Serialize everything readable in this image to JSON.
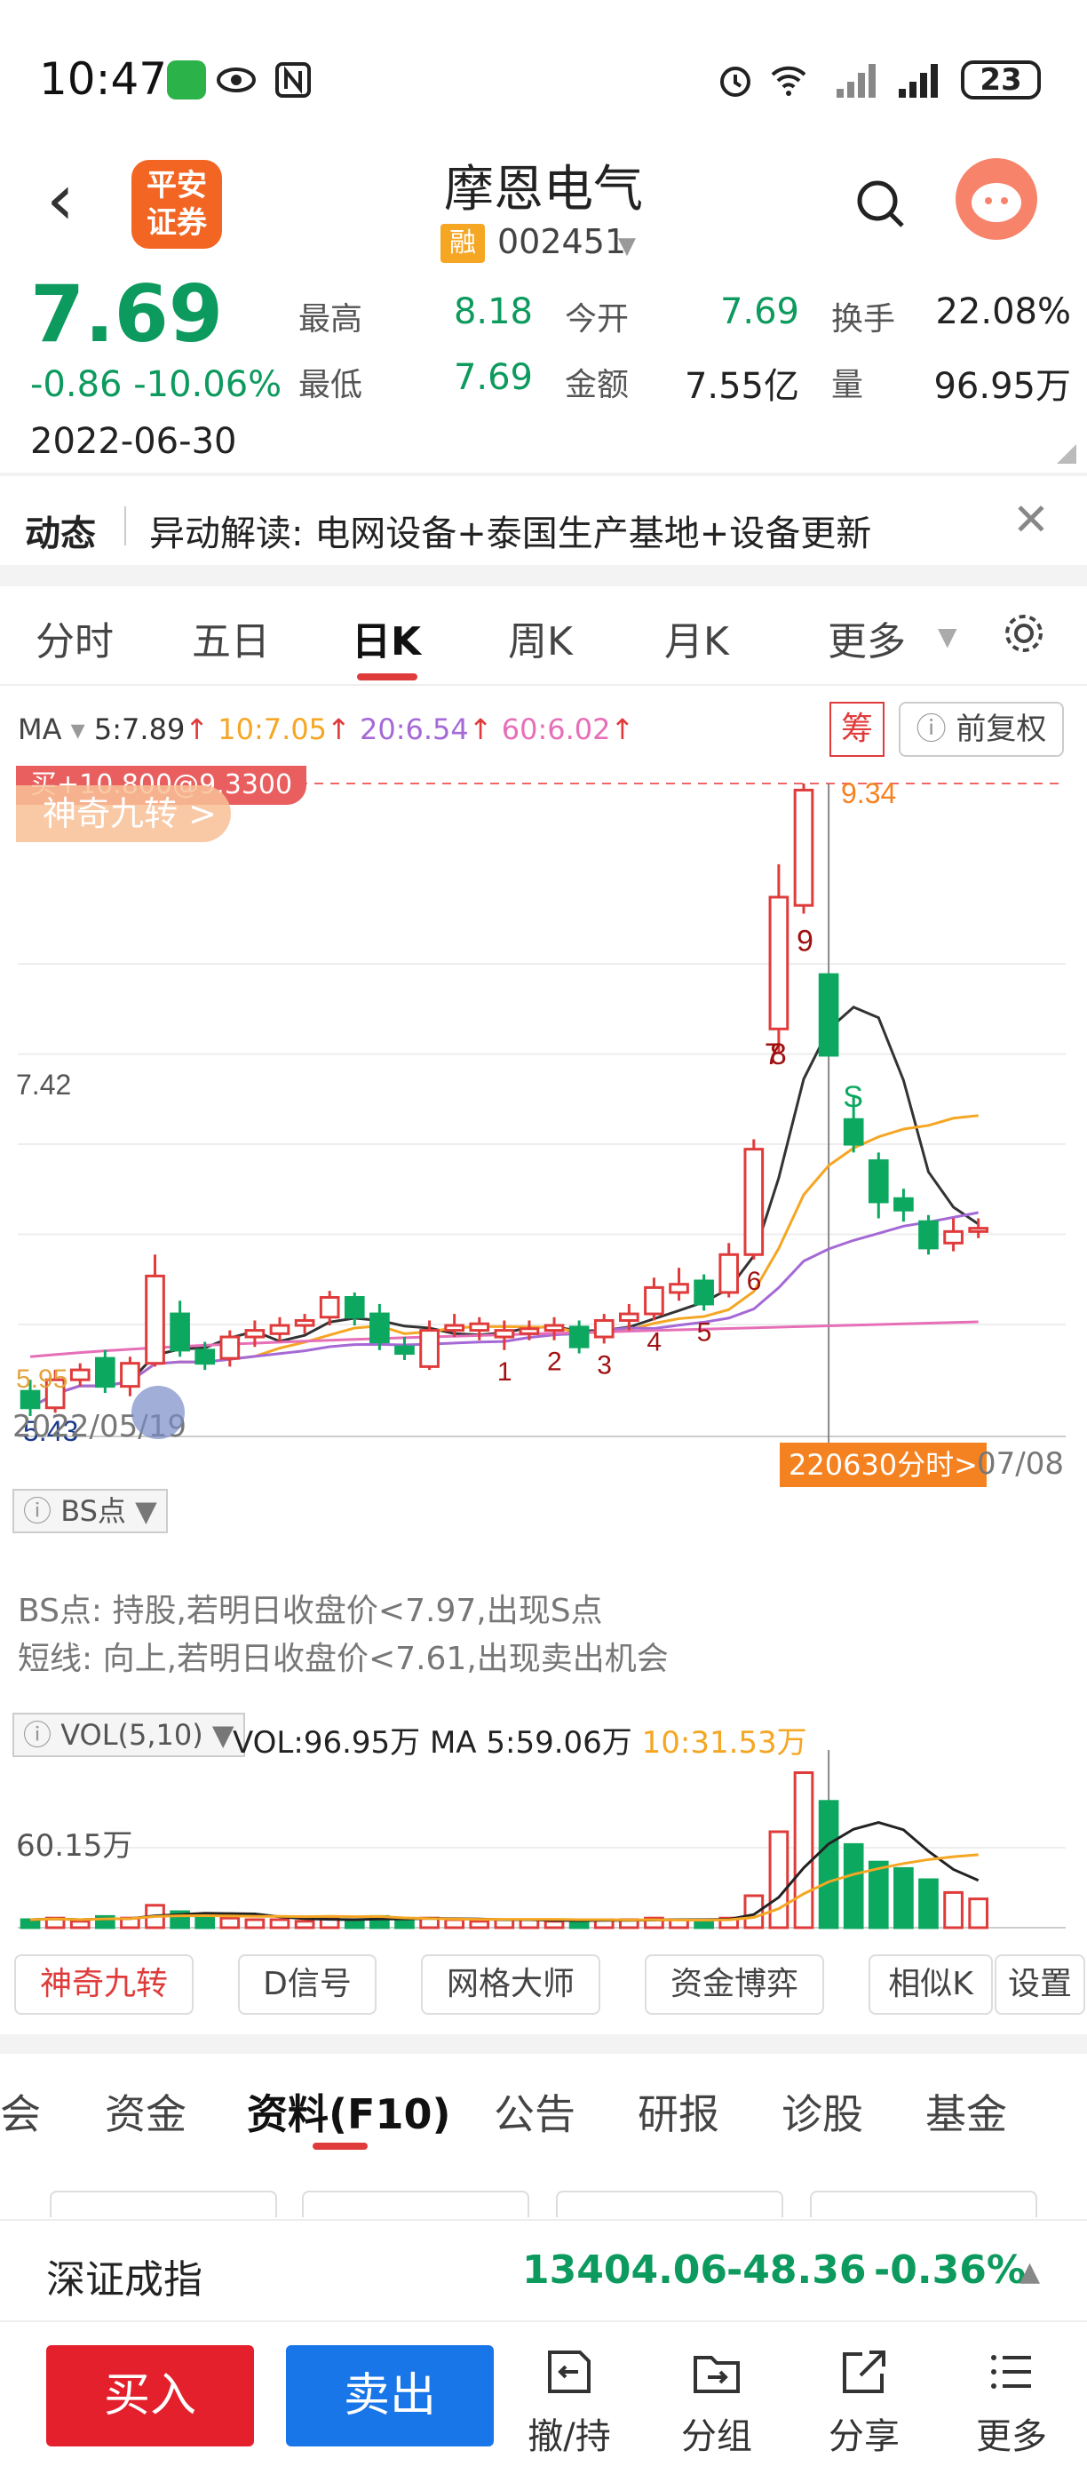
{
  "status_bar": {
    "time": "10:47",
    "battery": "23"
  },
  "header": {
    "back": "‹",
    "logo_line1": "平安",
    "logo_line2": "证券",
    "stock_name": "摩恩电气",
    "rong_badge": "融",
    "stock_code": "002451"
  },
  "quote": {
    "price": "7.69",
    "change": "-0.86 -10.06%",
    "date": "2022-06-30",
    "rows": [
      {
        "l1": "最高",
        "v1": "8.18",
        "l2": "今开",
        "v2": "7.69",
        "l3": "换手",
        "v3": "22.08%"
      },
      {
        "l1": "最低",
        "v1": "7.69",
        "l2": "金额",
        "v2": "7.55亿",
        "l3": "量",
        "v3": "96.95万"
      }
    ]
  },
  "news": {
    "tag": "动态",
    "text": "异动解读:  电网设备+泰国生产基地+设备更新"
  },
  "period_tabs": [
    "分时",
    "五日",
    "日K",
    "周K",
    "月K",
    "更多"
  ],
  "ma": {
    "label": "MA",
    "ma5": "5:7.89",
    "ma10": "10:7.05",
    "ma20": "20:6.54",
    "ma60": "60:6.02",
    "ma5_color": "#333333",
    "ma10_color": "#f5a623",
    "ma20_color": "#a569d6",
    "ma60_color": "#e66fb8"
  },
  "chart_controls": {
    "chip": "筹",
    "fq": "前复权"
  },
  "kline": {
    "promo_tag": "买+10.800@9.3300",
    "promo_button": "神奇九转 >",
    "high_label": "9.34",
    "mid_label": "7.42",
    "low_label": "5.43",
    "low_label_2": "5.95",
    "start_date": "2022/05/19",
    "cursor_date": "220630分时>",
    "end_date": "07/08",
    "sell_mark": "S",
    "nine_labels": [
      "7",
      "8",
      "9",
      "1",
      "2",
      "3",
      "4",
      "5",
      "6"
    ]
  },
  "bs": {
    "button": "BS点",
    "line1": "BS点: 持股,若明日收盘价<7.97,出现S点",
    "line2": "短线: 向上,若明日收盘价<7.61,出现卖出机会"
  },
  "volume": {
    "button": "VOL(5,10)",
    "vol": "VOL:96.95万",
    "ma5": "MA 5:59.06万",
    "ma10": "10:31.53万",
    "y_label": "60.15万"
  },
  "tools": [
    "神奇九转",
    "D信号",
    "网格大师",
    "资金博弈",
    "相似K",
    "设置"
  ],
  "info_tabs": [
    "会",
    "资金",
    "资料(F10)",
    "公告",
    "研报",
    "诊股",
    "基金"
  ],
  "index": {
    "name": "深证成指",
    "value": "13404.06",
    "change": "-48.36",
    "pct": "-0.36%"
  },
  "bottom": {
    "buy": "买入",
    "sell": "卖出",
    "nav": [
      "撤/持",
      "分组",
      "分享",
      "更多"
    ]
  },
  "chart_data": {
    "type": "candlestick",
    "title": "",
    "x_range": [
      "2022/05/19",
      "07/08"
    ],
    "y_labels": [
      "9.34",
      "7.42",
      "5.43"
    ],
    "candles": [
      {
        "o": 5.65,
        "c": 5.55,
        "h": 5.72,
        "l": 5.5
      },
      {
        "o": 5.55,
        "c": 5.72,
        "h": 5.78,
        "l": 5.52
      },
      {
        "o": 5.72,
        "c": 5.78,
        "h": 5.82,
        "l": 5.68
      },
      {
        "o": 5.85,
        "c": 5.68,
        "h": 5.9,
        "l": 5.64
      },
      {
        "o": 5.68,
        "c": 5.82,
        "h": 5.86,
        "l": 5.62
      },
      {
        "o": 5.82,
        "c": 6.35,
        "h": 6.48,
        "l": 5.8
      },
      {
        "o": 6.12,
        "c": 5.9,
        "h": 6.2,
        "l": 5.86
      },
      {
        "o": 5.9,
        "c": 5.82,
        "h": 5.95,
        "l": 5.78
      },
      {
        "o": 5.85,
        "c": 5.98,
        "h": 6.02,
        "l": 5.8
      },
      {
        "o": 5.98,
        "c": 6.02,
        "h": 6.08,
        "l": 5.92
      },
      {
        "o": 6.0,
        "c": 6.05,
        "h": 6.1,
        "l": 5.95
      },
      {
        "o": 6.05,
        "c": 6.08,
        "h": 6.12,
        "l": 6.0
      },
      {
        "o": 6.1,
        "c": 6.22,
        "h": 6.26,
        "l": 6.05
      },
      {
        "o": 6.22,
        "c": 6.1,
        "h": 6.25,
        "l": 6.05
      },
      {
        "o": 6.12,
        "c": 5.95,
        "h": 6.18,
        "l": 5.9
      },
      {
        "o": 5.92,
        "c": 5.88,
        "h": 5.98,
        "l": 5.84
      },
      {
        "o": 5.8,
        "c": 6.02,
        "h": 6.08,
        "l": 5.78
      },
      {
        "o": 6.02,
        "c": 6.05,
        "h": 6.12,
        "l": 5.98
      },
      {
        "o": 6.02,
        "c": 6.06,
        "h": 6.1,
        "l": 5.96
      },
      {
        "o": 5.98,
        "c": 6.02,
        "h": 6.08,
        "l": 5.9
      },
      {
        "o": 6.0,
        "c": 6.03,
        "h": 6.08,
        "l": 5.96
      },
      {
        "o": 6.02,
        "c": 6.05,
        "h": 6.1,
        "l": 5.96
      },
      {
        "o": 6.04,
        "c": 5.92,
        "h": 6.08,
        "l": 5.88
      },
      {
        "o": 5.98,
        "c": 6.08,
        "h": 6.12,
        "l": 5.94
      },
      {
        "o": 6.08,
        "c": 6.12,
        "h": 6.18,
        "l": 6.02
      },
      {
        "o": 6.12,
        "c": 6.28,
        "h": 6.34,
        "l": 6.08
      },
      {
        "o": 6.25,
        "c": 6.3,
        "h": 6.4,
        "l": 6.2
      },
      {
        "o": 6.32,
        "c": 6.18,
        "h": 6.36,
        "l": 6.14
      },
      {
        "o": 6.25,
        "c": 6.48,
        "h": 6.55,
        "l": 6.22
      },
      {
        "o": 6.48,
        "c": 7.12,
        "h": 7.18,
        "l": 6.45
      },
      {
        "o": 7.85,
        "c": 8.65,
        "h": 8.85,
        "l": 7.7
      },
      {
        "o": 8.6,
        "c": 9.3,
        "h": 9.34,
        "l": 8.55
      },
      {
        "o": 8.18,
        "c": 7.69,
        "h": 8.18,
        "l": 7.69
      },
      {
        "o": 7.3,
        "c": 7.15,
        "h": 7.45,
        "l": 7.1
      },
      {
        "o": 7.05,
        "c": 6.8,
        "h": 7.1,
        "l": 6.7
      },
      {
        "o": 6.82,
        "c": 6.75,
        "h": 6.88,
        "l": 6.68
      },
      {
        "o": 6.68,
        "c": 6.52,
        "h": 6.72,
        "l": 6.48
      },
      {
        "o": 6.55,
        "c": 6.62,
        "h": 6.7,
        "l": 6.5
      },
      {
        "o": 6.62,
        "c": 6.64,
        "h": 6.7,
        "l": 6.58
      }
    ],
    "volume": [
      5,
      6,
      4,
      7,
      6,
      14,
      10,
      8,
      6,
      5,
      5,
      4,
      6,
      5,
      7,
      5,
      6,
      5,
      4,
      5,
      5,
      4,
      4,
      5,
      5,
      6,
      5,
      4,
      6,
      20,
      60,
      96.95,
      79,
      52,
      41,
      37,
      30,
      22,
      18
    ]
  }
}
